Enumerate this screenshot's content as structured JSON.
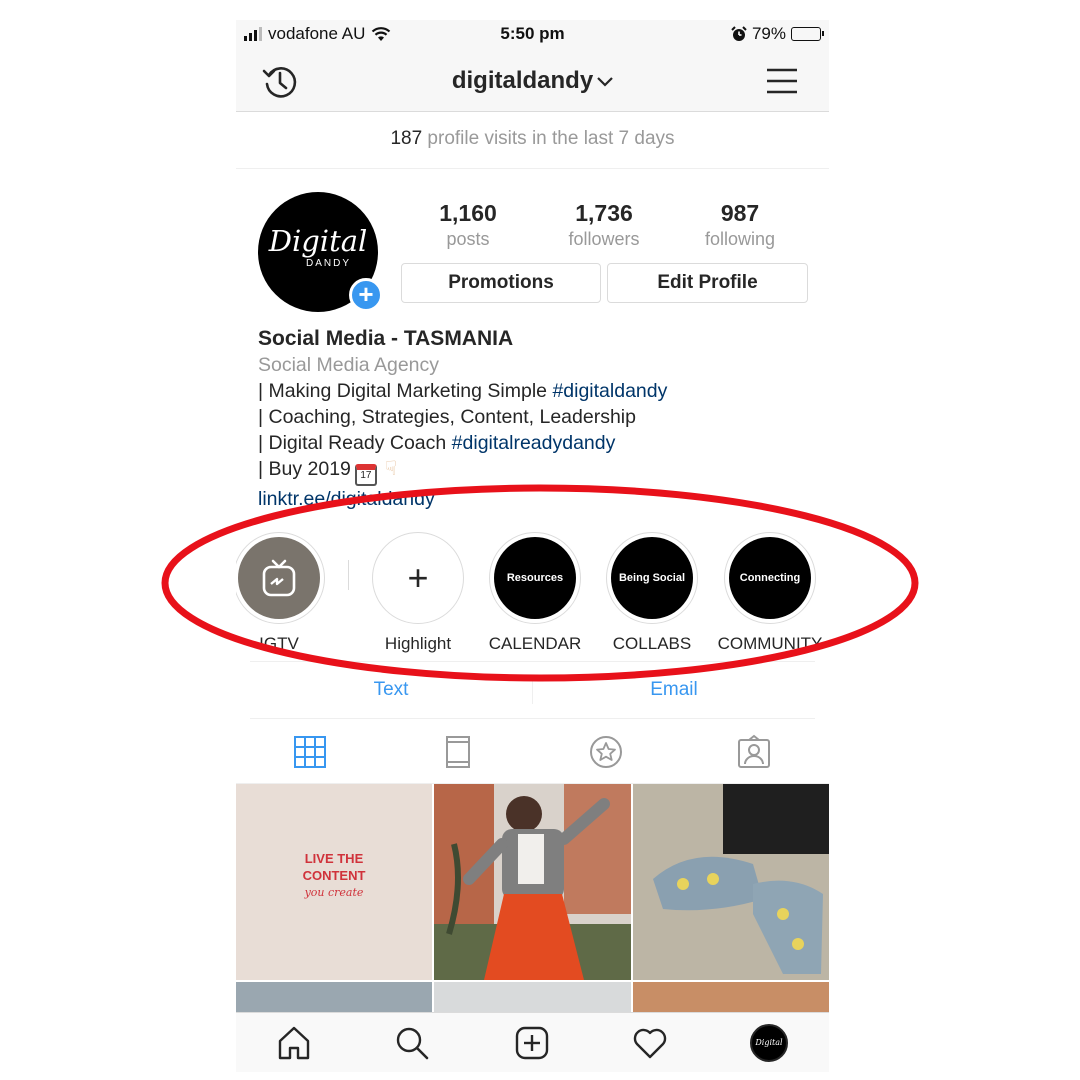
{
  "status_bar": {
    "carrier": "vodafone AU",
    "time": "5:50 pm",
    "battery": "79%",
    "battery_level": 0.79
  },
  "nav": {
    "username": "digitaldandy"
  },
  "visits": {
    "count": "187",
    "text": "profile visits in the last 7 days"
  },
  "avatar": {
    "script": "Digital",
    "sub": "DANDY"
  },
  "stats": [
    {
      "value": "1,160",
      "label": "posts"
    },
    {
      "value": "1,736",
      "label": "followers"
    },
    {
      "value": "987",
      "label": "following"
    }
  ],
  "buttons": {
    "promotions": "Promotions",
    "edit_profile": "Edit Profile"
  },
  "bio": {
    "name": "Social Media - TASMANIA",
    "category": "Social Media Agency",
    "line1": "| Making Digital Marketing Simple ",
    "line1_tag": "#digitaldandy",
    "line2": "| Coaching, Strategies, Content, Leadership",
    "line3": "| Digital Ready Coach ",
    "line3_tag": "#digitalreadydandy",
    "line4": "| Buy 2019",
    "calendar_day": "17",
    "link": "linktr.ee/digitaldandy"
  },
  "highlights": [
    {
      "label": "IGTV",
      "cover": ""
    },
    {
      "label": "Highlight",
      "cover": "+"
    },
    {
      "label": "CALENDAR",
      "cover": "Resources"
    },
    {
      "label": "COLLABS",
      "cover": "Being Social"
    },
    {
      "label": "COMMUNITY",
      "cover": "Connecting"
    }
  ],
  "contact": {
    "text": "Text",
    "email": "Email"
  },
  "grid": {
    "tile1_line1": "LIVE THE",
    "tile1_line2": "CONTENT",
    "tile1_script": "you create"
  },
  "colors": {
    "accent": "#3897f0",
    "link": "#003569",
    "annotation": "#e8111a"
  }
}
